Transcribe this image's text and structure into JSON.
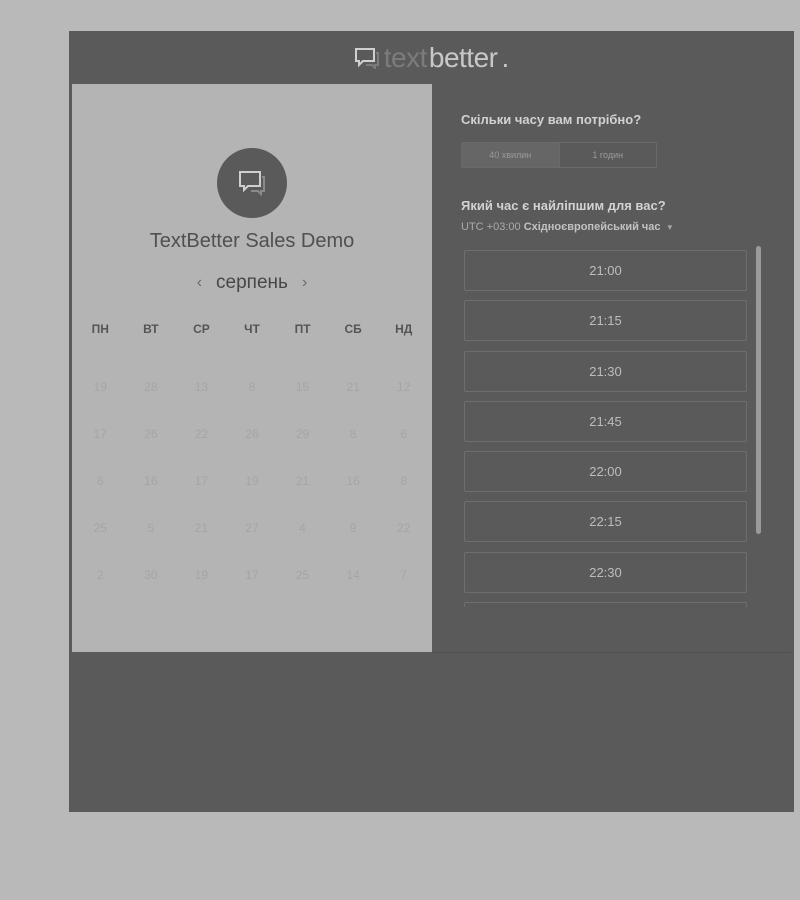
{
  "logo": {
    "text_light": "text",
    "text_bold": "better",
    "dot": "."
  },
  "event": {
    "title": "TextBetter Sales Demo"
  },
  "calendar": {
    "month": "серпень",
    "prev_icon": "‹",
    "next_icon": "›",
    "weekdays": [
      "ПН",
      "ВТ",
      "СР",
      "ЧТ",
      "ПТ",
      "СБ",
      "НД"
    ],
    "days": [
      "19",
      "28",
      "13",
      "8",
      "15",
      "21",
      "12",
      "17",
      "26",
      "22",
      "26",
      "29",
      "8",
      "6",
      "6",
      "16",
      "17",
      "19",
      "21",
      "16",
      "8",
      "25",
      "5",
      "21",
      "27",
      "4",
      "9",
      "22",
      "2",
      "30",
      "19",
      "17",
      "25",
      "14",
      "7"
    ]
  },
  "duration": {
    "question": "Скільки часу вам потрібно?",
    "options": [
      "40 хвилин",
      "1 годин"
    ],
    "selected": 0
  },
  "time": {
    "question": "Який час є найліпшим для вас?",
    "tz_offset": "UTC +03:00",
    "tz_name": "Східноєвропейський час",
    "tz_caret": "▾",
    "slots": [
      "21:00",
      "21:15",
      "21:30",
      "21:45",
      "22:00",
      "22:15",
      "22:30",
      ""
    ]
  }
}
